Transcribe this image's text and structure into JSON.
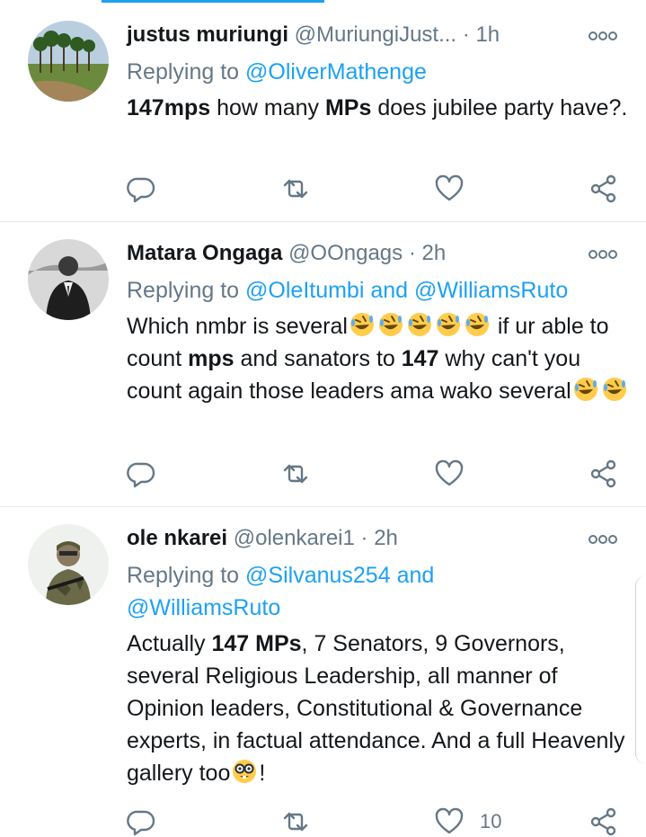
{
  "colors": {
    "accent": "#1da1f2",
    "muted": "#657786",
    "text": "#14171a",
    "divider": "#e1e8ed"
  },
  "tweets": [
    {
      "name": "justus muriungi",
      "handle": "@MuriungiJust...",
      "dot": "·",
      "time": "1h",
      "reply_prefix": "Replying to",
      "reply_links": "@OliverMathenge",
      "body_bold1": "147mps",
      "body_text1": " how many ",
      "body_bold2": "MPs",
      "body_text2": " does  jubilee party have?.",
      "avatar_icon": "landscape-avatar"
    },
    {
      "name": "Matara Ongaga",
      "handle": "@OOngags",
      "dot": "·",
      "time": "2h",
      "reply_prefix": "Replying to",
      "reply_links": "@OleItumbi and @WilliamsRuto",
      "body_text1": "Which nmbr is several",
      "body_text2": " if ur able to count ",
      "body_bold1": "mps",
      "body_text3": " and sanators to ",
      "body_bold2": "147",
      "body_text4": " why can't you count again those leaders ama wako several",
      "emoji_icon": "rofl-emoji",
      "avatar_icon": "person-suit-avatar"
    },
    {
      "name": "ole nkarei",
      "handle": "@olenkarei1",
      "dot": "·",
      "time": "2h",
      "reply_prefix": "Replying to",
      "reply_link1": "@Silvanus254",
      "reply_and": " and",
      "reply_link2": "@WilliamsRuto",
      "body_text1": "Actually ",
      "body_bold1": "147 MPs",
      "body_text2": ", 7 Senators, 9 Governors, several Religious Leadership, all manner of Opinion leaders, Constitutional & Governance experts, in factual attendance. And a full Heavenly gallery too",
      "body_text3": "!",
      "like_count": "10",
      "emoji_icon": "nerd-emoji",
      "avatar_icon": "soldier-avatar"
    }
  ],
  "icons": [
    "reply-icon",
    "retweet-icon",
    "like-icon",
    "share-icon",
    "more-icon"
  ]
}
